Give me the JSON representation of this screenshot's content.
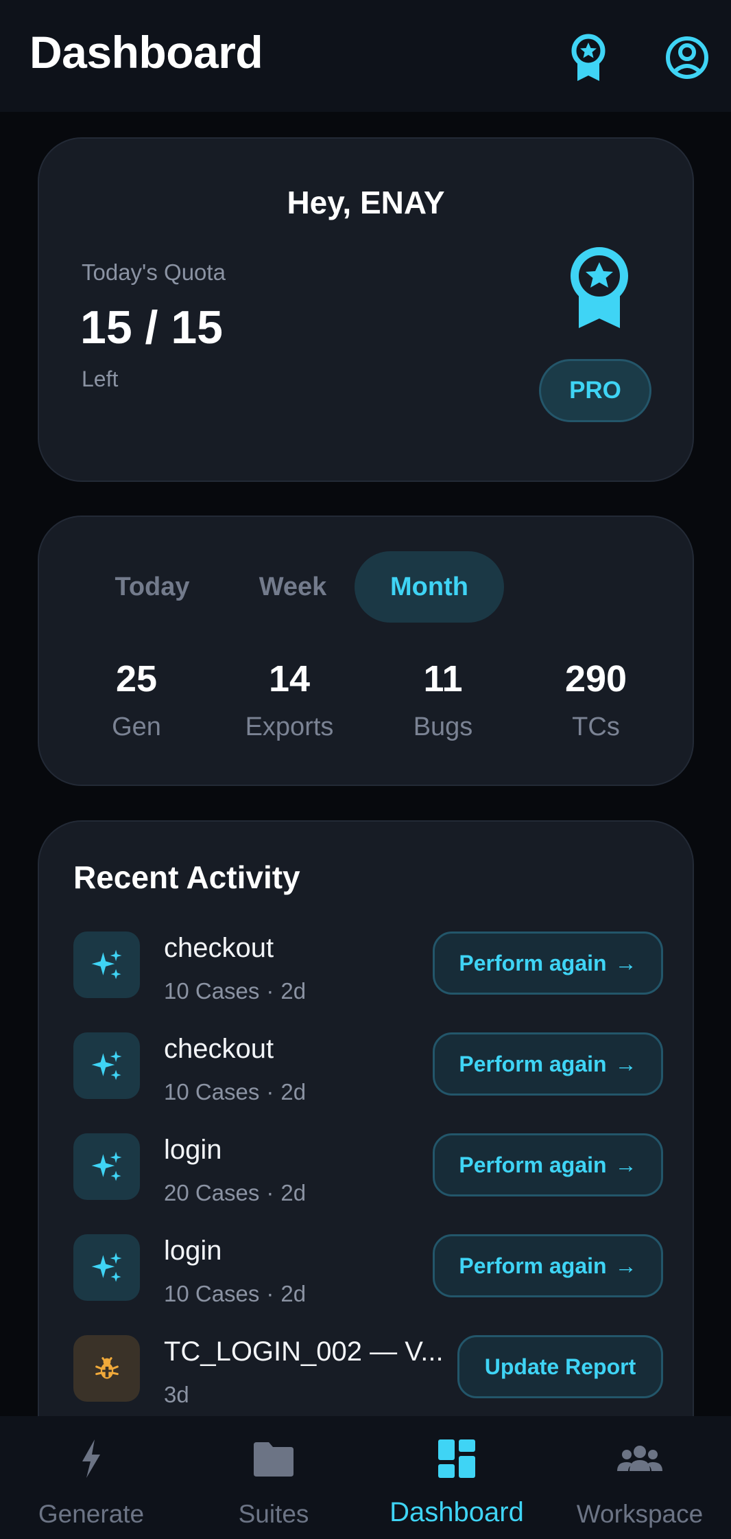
{
  "header": {
    "title": "Dashboard",
    "award_icon": "award-icon",
    "account_icon": "account-circle-icon"
  },
  "quota_card": {
    "greeting": "Hey, ENAY",
    "label": "Today's Quota",
    "value": "15 / 15",
    "sub": "Left",
    "badge_icon": "award-icon",
    "badge": "PRO"
  },
  "stats_card": {
    "tabs": [
      {
        "label": "Today",
        "active": false
      },
      {
        "label": "Week",
        "active": false
      },
      {
        "label": "Month",
        "active": true
      }
    ],
    "stats": [
      {
        "value": "25",
        "label": "Gen"
      },
      {
        "value": "14",
        "label": "Exports"
      },
      {
        "value": "11",
        "label": "Bugs"
      },
      {
        "value": "290",
        "label": "TCs"
      }
    ]
  },
  "activity": {
    "title": "Recent Activity",
    "items": [
      {
        "name": "checkout",
        "cases": "10 Cases",
        "age": "2d",
        "icon": "sparkles-icon",
        "action": "Perform again"
      },
      {
        "name": "checkout",
        "cases": "10 Cases",
        "age": "2d",
        "icon": "sparkles-icon",
        "action": "Perform again"
      },
      {
        "name": "login",
        "cases": "20 Cases",
        "age": "2d",
        "icon": "sparkles-icon",
        "action": "Perform again"
      },
      {
        "name": "login",
        "cases": "10 Cases",
        "age": "2d",
        "icon": "sparkles-icon",
        "action": "Perform again"
      },
      {
        "name": "TC_LOGIN_002 — V...",
        "age": "3d",
        "icon": "bug-icon",
        "action": "Update Report"
      }
    ]
  },
  "nav": {
    "items": [
      {
        "label": "Generate",
        "icon": "bolt-icon",
        "active": false
      },
      {
        "label": "Suites",
        "icon": "folder-icon",
        "active": false
      },
      {
        "label": "Dashboard",
        "icon": "dashboard-icon",
        "active": true
      },
      {
        "label": "Workspace",
        "icon": "group-icon",
        "active": false
      }
    ]
  },
  "colors": {
    "accent": "#3fd4f5",
    "background": "#07090d",
    "card": "#171c25",
    "muted": "#8b93a3",
    "bug": "#f0a93a"
  }
}
